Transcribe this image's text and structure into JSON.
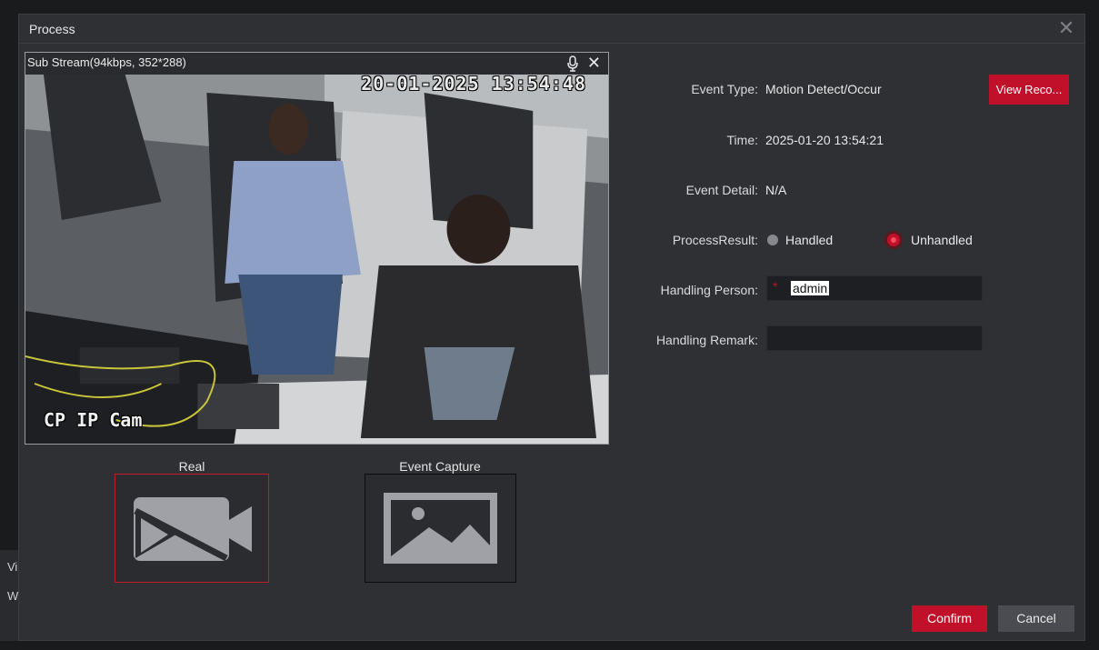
{
  "dialog": {
    "title": "Process",
    "close_icon": "close-icon"
  },
  "background": {
    "partial_label_1": "Vi",
    "partial_label_2": "W"
  },
  "video": {
    "stream_title": "Sub Stream(94kbps, 352*288)",
    "osd_timestamp": "20-01-2025 13:54:48",
    "osd_camera_name": "CP IP Cam",
    "mic_icon": "microphone-icon",
    "close_icon": "close-icon"
  },
  "thumbnails": {
    "real_label": "Real",
    "capture_label": "Event Capture",
    "real_icon": "video-camera-off-icon",
    "capture_icon": "image-icon"
  },
  "event": {
    "type_label": "Event Type:",
    "type_value": "Motion Detect/Occur",
    "view_record_label": "View Reco...",
    "time_label": "Time:",
    "time_value": "2025-01-20 13:54:21",
    "detail_label": "Event Detail:",
    "detail_value": "N/A",
    "result_label": "ProcessResult:",
    "result_options": [
      "Handled",
      "Unhandled"
    ],
    "result_selected": "Unhandled",
    "person_label": "Handling Person:",
    "person_required_mark": "*",
    "person_value": "admin",
    "remark_label": "Handling Remark:",
    "remark_value": ""
  },
  "actions": {
    "confirm_label": "Confirm",
    "cancel_label": "Cancel"
  },
  "colors": {
    "accent": "#c0102a",
    "dialog_bg": "#2e3034",
    "input_bg": "#1e1f22"
  }
}
